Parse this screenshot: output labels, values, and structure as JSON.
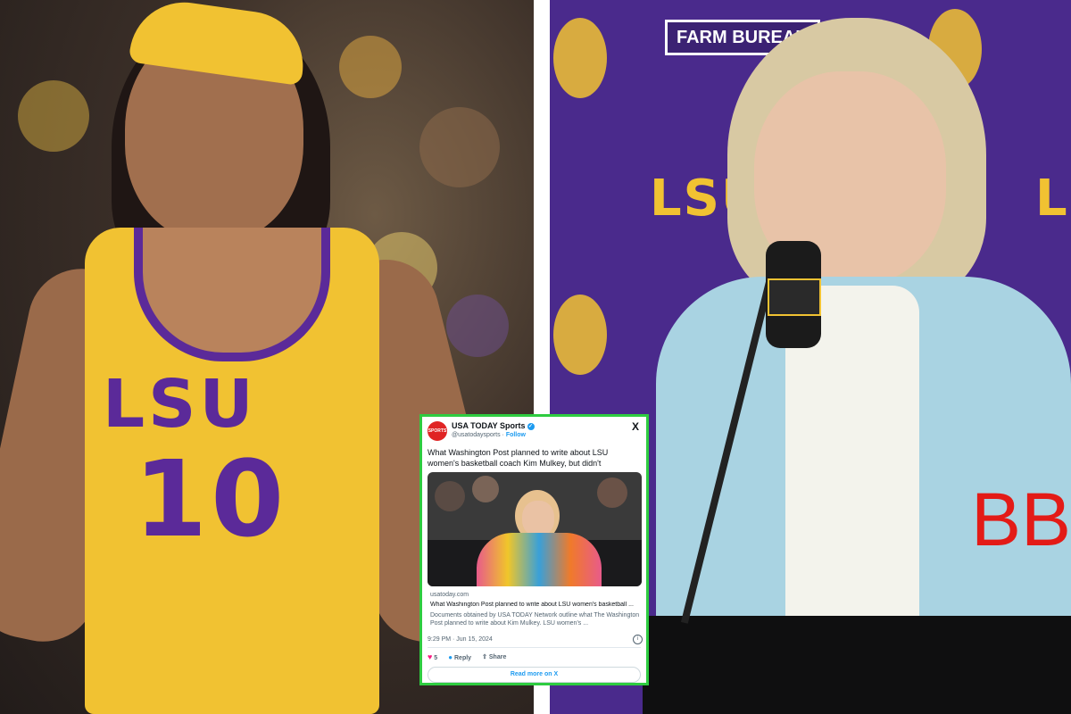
{
  "left_photo": {
    "jersey_lettering": "LSU",
    "jersey_number": "10"
  },
  "right_photo": {
    "backdrop_logo": "LSU",
    "sponsor_text": "FARM BUREAU",
    "overlay_text": "BB",
    "overlay_color": "#e31b17"
  },
  "tweet": {
    "avatar_text": "SPORTS",
    "account_name": "USA TODAY Sports",
    "handle": "@usatodaysports",
    "follow_label": "Follow",
    "close_icon": "X",
    "text": "What Washington Post planned to write about LSU women's basketball coach Kim Mulkey, but didn't",
    "link_domain": "usatoday.com",
    "link_title": "What Washington Post planned to write about LSU women's basketball ...",
    "link_description": "Documents obtained by USA TODAY Network outline what The Washington Post planned to write about Kim Mulkey. LSU women's ...",
    "timestamp": "9:29 PM · Jun 15, 2024",
    "like_count": "5",
    "reply_label": "Reply",
    "share_label": "Share",
    "read_more_label": "Read more on X",
    "border_color": "#2ecc40"
  }
}
